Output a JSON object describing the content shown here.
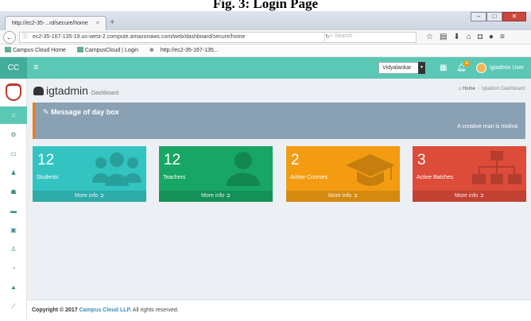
{
  "caption": "Fig. 3: Login Page",
  "browser": {
    "tab_title": "http://ec2-35-...rd/secure/home",
    "tab_close": "×",
    "new_tab": "+",
    "url": "ec2-35-167-135-19.us-west-2.compute.amazonaws.com/web/dashboard/secure/home",
    "search_placeholder": "Search",
    "bookmarks": [
      "Campus Cloud Home",
      "CampusCloud | Login",
      "http://ec2-35-167-135..."
    ]
  },
  "app": {
    "brand": "CC",
    "institute_select": "Vidyalankar",
    "notification_count": "4",
    "user_name": "igtadmin User"
  },
  "page": {
    "title": "igtadmin",
    "subtitle": "Dashboard",
    "breadcrumb": {
      "home": "Home",
      "current": "Igtadmin Dashboard"
    }
  },
  "message_box": {
    "heading": "Message of day box",
    "text": "A creative man is motiva"
  },
  "stats": [
    {
      "value": "12",
      "label": "Students",
      "more": "More info",
      "color": "#33c3c0",
      "icon": "users-icon"
    },
    {
      "value": "12",
      "label": "Teachers",
      "more": "More info",
      "color": "#17a665",
      "icon": "user-icon"
    },
    {
      "value": "2",
      "label": "Active Courses",
      "more": "More info",
      "color": "#f39c12",
      "icon": "graduation-cap-icon"
    },
    {
      "value": "3",
      "label": "Active Batches",
      "more": "More info",
      "color": "#dd4b39",
      "icon": "sitemap-icon"
    }
  ],
  "footer": {
    "prefix": "Copyright © 2017",
    "company": "Campus Cloud LLP.",
    "suffix": "All rights reserved."
  }
}
